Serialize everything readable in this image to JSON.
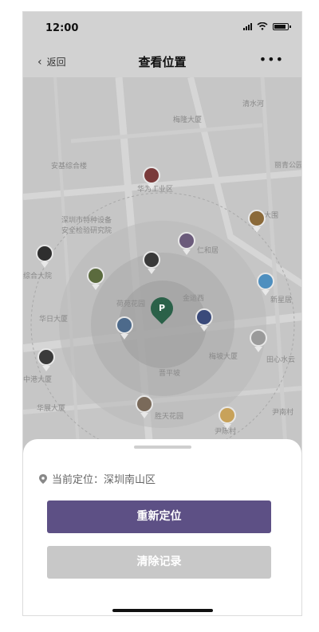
{
  "status_bar": {
    "time": "12:00"
  },
  "nav": {
    "back_label": "返回",
    "title": "查看位置",
    "more_label": "•••"
  },
  "map": {
    "pois": [
      "清水河",
      "梅隆大厦",
      "丽青公园",
      "安基综合楼",
      "华为工业区",
      "深圳市特种设备\n安全检验研究院",
      "大围",
      "仁和居",
      "金运西",
      "综合大院",
      "新星居",
      "华日大厦",
      "荷苑花园",
      "中港大厦",
      "田心水云",
      "梅坡大厦",
      "晋平坡",
      "华展大厦",
      "胜天花园",
      "尹陈村",
      "尹南村"
    ],
    "center_marker_label": "P",
    "avatar_colors": [
      "#7a3a3a",
      "#3a4a7a",
      "#5b6b3e",
      "#4d6a8b",
      "#8b6a3a",
      "#2f2f2f",
      "#6b5b7b",
      "#c8a25a",
      "#4e8fbf",
      "#3a3a3a",
      "#9a9a9a",
      "#7a6a5a"
    ]
  },
  "sheet": {
    "location_label": "当前定位：深圳南山区",
    "relocate_label": "重新定位",
    "clear_label": "清除记录"
  }
}
